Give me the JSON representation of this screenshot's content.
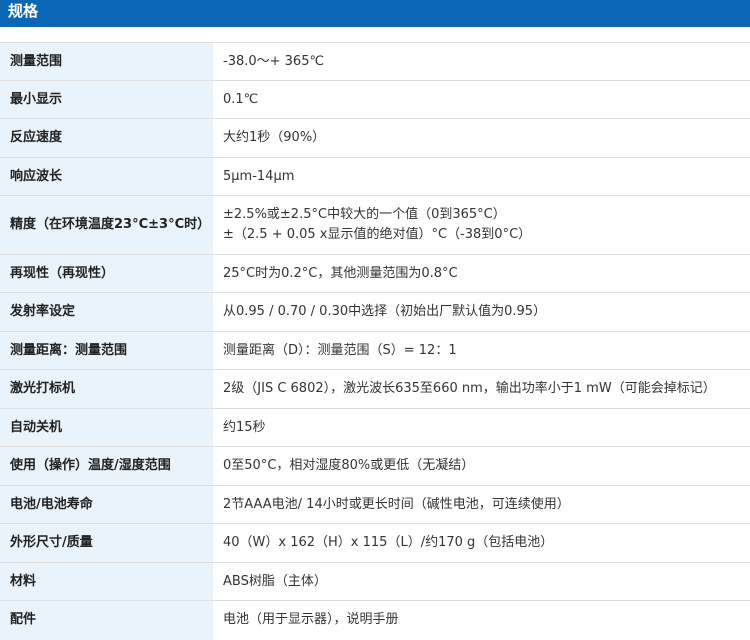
{
  "header": {
    "title": "规格"
  },
  "rows": [
    {
      "label": "测量范围",
      "value": [
        "-38.0～+ 365℃"
      ]
    },
    {
      "label": "最小显示",
      "value": [
        "0.1℃"
      ]
    },
    {
      "label": "反应速度",
      "value": [
        "大约1秒（90%）"
      ]
    },
    {
      "label": "响应波长",
      "value": [
        "5μm-14μm"
      ]
    },
    {
      "label": "精度（在环境温度23°C±3°C时）",
      "value": [
        "±2.5%或±2.5°C中较大的一个值（0到365°C）",
        "±（2.5 + 0.05 x显示值的绝对值）°C（-38到0°C）"
      ]
    },
    {
      "label": "再现性（再现性）",
      "value": [
        "25°C时为0.2°C，其他测量范围为0.8°C"
      ]
    },
    {
      "label": "发射率设定",
      "value": [
        "从0.95 / 0.70 / 0.30中选择（初始出厂默认值为0.95）"
      ]
    },
    {
      "label": "测量距离：测量范围",
      "value": [
        "测量距离（D）：测量范围（S）= 12：1"
      ]
    },
    {
      "label": "激光打标机",
      "value": [
        "2级（JIS C 6802），激光波长635至660 nm，输出功率小于1 mW（可能会掉标记）"
      ]
    },
    {
      "label": "自动关机",
      "value": [
        "约15秒"
      ]
    },
    {
      "label": "使用（操作）温度/湿度范围",
      "value": [
        "0至50°C，相对湿度80%或更低（无凝结）"
      ]
    },
    {
      "label": "电池/电池寿命",
      "value": [
        "2节AAA电池/ 14小时或更长时间（碱性电池，可连续使用）"
      ]
    },
    {
      "label": "外形尺寸/质量",
      "value": [
        "40（W）x 162（H）x 115（L）/约170 g（包括电池）"
      ]
    },
    {
      "label": "材料",
      "value": [
        "ABS树脂（主体）"
      ]
    },
    {
      "label": "配件",
      "value": [
        "电池（用于显示器），说明手册"
      ]
    }
  ]
}
